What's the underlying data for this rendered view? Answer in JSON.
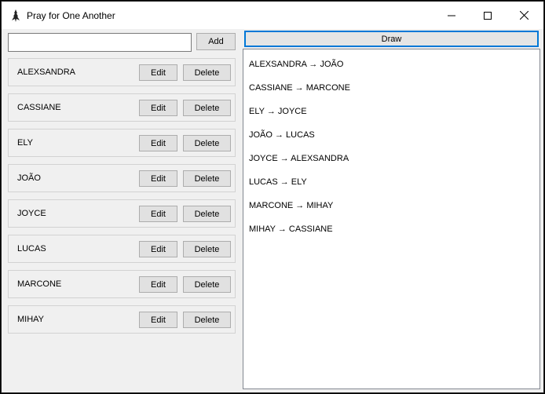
{
  "window": {
    "title": "Pray for One Another"
  },
  "titlebar_buttons": [
    "minimize-icon",
    "maximize-icon",
    "close-icon"
  ],
  "left": {
    "input_value": "",
    "add_label": "Add",
    "edit_label": "Edit",
    "delete_label": "Delete",
    "people": [
      "ALEXSANDRA",
      "CASSIANE",
      "ELY",
      "JOÃO",
      "JOYCE",
      "LUCAS",
      "MARCONE",
      "MIHAY"
    ]
  },
  "right": {
    "draw_label": "Draw",
    "pairs": [
      "ALEXSANDRA → JOÃO",
      "CASSIANE → MARCONE",
      "ELY → JOYCE",
      "JOÃO → LUCAS",
      "JOYCE → ALEXSANDRA",
      "LUCAS → ELY",
      "MARCONE → MIHAY",
      "MIHAY → CASSIANE"
    ]
  },
  "colors": {
    "focus_border": "#0078d7",
    "button_bg": "#e1e1e1"
  }
}
